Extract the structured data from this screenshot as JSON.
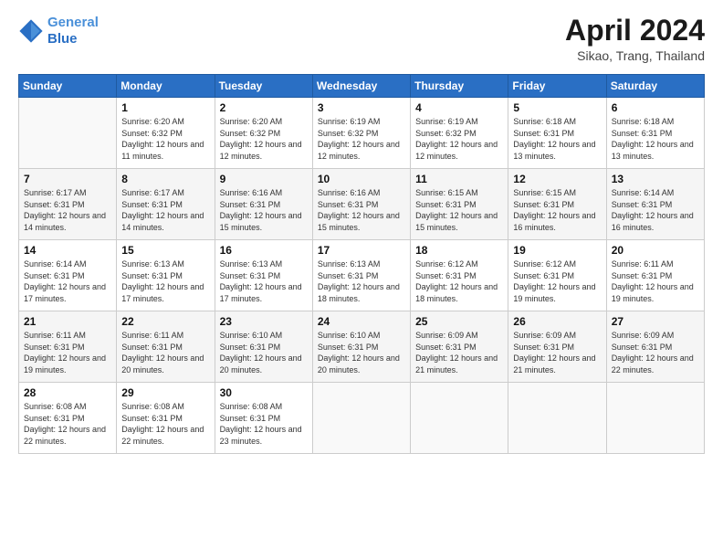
{
  "header": {
    "logo_line1": "General",
    "logo_line2": "Blue",
    "month_title": "April 2024",
    "subtitle": "Sikao, Trang, Thailand"
  },
  "weekdays": [
    "Sunday",
    "Monday",
    "Tuesday",
    "Wednesday",
    "Thursday",
    "Friday",
    "Saturday"
  ],
  "weeks": [
    [
      {
        "day": "",
        "sunrise": "",
        "sunset": "",
        "daylight": ""
      },
      {
        "day": "1",
        "sunrise": "Sunrise: 6:20 AM",
        "sunset": "Sunset: 6:32 PM",
        "daylight": "Daylight: 12 hours and 11 minutes."
      },
      {
        "day": "2",
        "sunrise": "Sunrise: 6:20 AM",
        "sunset": "Sunset: 6:32 PM",
        "daylight": "Daylight: 12 hours and 12 minutes."
      },
      {
        "day": "3",
        "sunrise": "Sunrise: 6:19 AM",
        "sunset": "Sunset: 6:32 PM",
        "daylight": "Daylight: 12 hours and 12 minutes."
      },
      {
        "day": "4",
        "sunrise": "Sunrise: 6:19 AM",
        "sunset": "Sunset: 6:32 PM",
        "daylight": "Daylight: 12 hours and 12 minutes."
      },
      {
        "day": "5",
        "sunrise": "Sunrise: 6:18 AM",
        "sunset": "Sunset: 6:31 PM",
        "daylight": "Daylight: 12 hours and 13 minutes."
      },
      {
        "day": "6",
        "sunrise": "Sunrise: 6:18 AM",
        "sunset": "Sunset: 6:31 PM",
        "daylight": "Daylight: 12 hours and 13 minutes."
      }
    ],
    [
      {
        "day": "7",
        "sunrise": "Sunrise: 6:17 AM",
        "sunset": "Sunset: 6:31 PM",
        "daylight": "Daylight: 12 hours and 14 minutes."
      },
      {
        "day": "8",
        "sunrise": "Sunrise: 6:17 AM",
        "sunset": "Sunset: 6:31 PM",
        "daylight": "Daylight: 12 hours and 14 minutes."
      },
      {
        "day": "9",
        "sunrise": "Sunrise: 6:16 AM",
        "sunset": "Sunset: 6:31 PM",
        "daylight": "Daylight: 12 hours and 15 minutes."
      },
      {
        "day": "10",
        "sunrise": "Sunrise: 6:16 AM",
        "sunset": "Sunset: 6:31 PM",
        "daylight": "Daylight: 12 hours and 15 minutes."
      },
      {
        "day": "11",
        "sunrise": "Sunrise: 6:15 AM",
        "sunset": "Sunset: 6:31 PM",
        "daylight": "Daylight: 12 hours and 15 minutes."
      },
      {
        "day": "12",
        "sunrise": "Sunrise: 6:15 AM",
        "sunset": "Sunset: 6:31 PM",
        "daylight": "Daylight: 12 hours and 16 minutes."
      },
      {
        "day": "13",
        "sunrise": "Sunrise: 6:14 AM",
        "sunset": "Sunset: 6:31 PM",
        "daylight": "Daylight: 12 hours and 16 minutes."
      }
    ],
    [
      {
        "day": "14",
        "sunrise": "Sunrise: 6:14 AM",
        "sunset": "Sunset: 6:31 PM",
        "daylight": "Daylight: 12 hours and 17 minutes."
      },
      {
        "day": "15",
        "sunrise": "Sunrise: 6:13 AM",
        "sunset": "Sunset: 6:31 PM",
        "daylight": "Daylight: 12 hours and 17 minutes."
      },
      {
        "day": "16",
        "sunrise": "Sunrise: 6:13 AM",
        "sunset": "Sunset: 6:31 PM",
        "daylight": "Daylight: 12 hours and 17 minutes."
      },
      {
        "day": "17",
        "sunrise": "Sunrise: 6:13 AM",
        "sunset": "Sunset: 6:31 PM",
        "daylight": "Daylight: 12 hours and 18 minutes."
      },
      {
        "day": "18",
        "sunrise": "Sunrise: 6:12 AM",
        "sunset": "Sunset: 6:31 PM",
        "daylight": "Daylight: 12 hours and 18 minutes."
      },
      {
        "day": "19",
        "sunrise": "Sunrise: 6:12 AM",
        "sunset": "Sunset: 6:31 PM",
        "daylight": "Daylight: 12 hours and 19 minutes."
      },
      {
        "day": "20",
        "sunrise": "Sunrise: 6:11 AM",
        "sunset": "Sunset: 6:31 PM",
        "daylight": "Daylight: 12 hours and 19 minutes."
      }
    ],
    [
      {
        "day": "21",
        "sunrise": "Sunrise: 6:11 AM",
        "sunset": "Sunset: 6:31 PM",
        "daylight": "Daylight: 12 hours and 19 minutes."
      },
      {
        "day": "22",
        "sunrise": "Sunrise: 6:11 AM",
        "sunset": "Sunset: 6:31 PM",
        "daylight": "Daylight: 12 hours and 20 minutes."
      },
      {
        "day": "23",
        "sunrise": "Sunrise: 6:10 AM",
        "sunset": "Sunset: 6:31 PM",
        "daylight": "Daylight: 12 hours and 20 minutes."
      },
      {
        "day": "24",
        "sunrise": "Sunrise: 6:10 AM",
        "sunset": "Sunset: 6:31 PM",
        "daylight": "Daylight: 12 hours and 20 minutes."
      },
      {
        "day": "25",
        "sunrise": "Sunrise: 6:09 AM",
        "sunset": "Sunset: 6:31 PM",
        "daylight": "Daylight: 12 hours and 21 minutes."
      },
      {
        "day": "26",
        "sunrise": "Sunrise: 6:09 AM",
        "sunset": "Sunset: 6:31 PM",
        "daylight": "Daylight: 12 hours and 21 minutes."
      },
      {
        "day": "27",
        "sunrise": "Sunrise: 6:09 AM",
        "sunset": "Sunset: 6:31 PM",
        "daylight": "Daylight: 12 hours and 22 minutes."
      }
    ],
    [
      {
        "day": "28",
        "sunrise": "Sunrise: 6:08 AM",
        "sunset": "Sunset: 6:31 PM",
        "daylight": "Daylight: 12 hours and 22 minutes."
      },
      {
        "day": "29",
        "sunrise": "Sunrise: 6:08 AM",
        "sunset": "Sunset: 6:31 PM",
        "daylight": "Daylight: 12 hours and 22 minutes."
      },
      {
        "day": "30",
        "sunrise": "Sunrise: 6:08 AM",
        "sunset": "Sunset: 6:31 PM",
        "daylight": "Daylight: 12 hours and 23 minutes."
      },
      {
        "day": "",
        "sunrise": "",
        "sunset": "",
        "daylight": ""
      },
      {
        "day": "",
        "sunrise": "",
        "sunset": "",
        "daylight": ""
      },
      {
        "day": "",
        "sunrise": "",
        "sunset": "",
        "daylight": ""
      },
      {
        "day": "",
        "sunrise": "",
        "sunset": "",
        "daylight": ""
      }
    ]
  ]
}
